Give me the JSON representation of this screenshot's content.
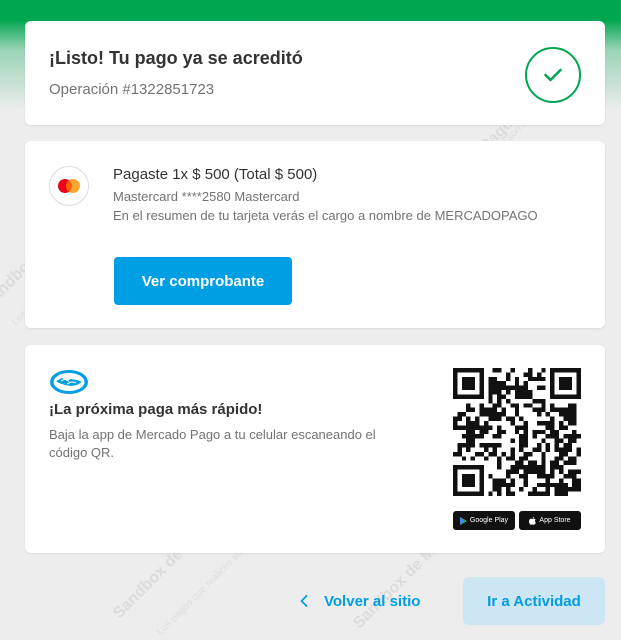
{
  "status": {
    "title": "¡Listo! Tu pago ya se acreditó",
    "operation": "Operación #1322851723",
    "icon": "check-icon",
    "color": "#00a650"
  },
  "payment": {
    "title": "Pagaste 1x $ 500 (Total $ 500)",
    "card": "Mastercard ****2580 Mastercard",
    "note": "En el resumen de tu tarjeta verás el cargo a nombre de MERCADOPAGO",
    "receipt_button": "Ver comprobante",
    "icon": "mastercard-icon"
  },
  "app_promo": {
    "title": "¡La próxima paga más rápido!",
    "text": "Baja la app de Mercado Pago a tu celular escaneando el código QR.",
    "google_play": "Google Play",
    "app_store": "App Store",
    "logo": "mercado-pago-logo"
  },
  "footer": {
    "back_label": "Volver al sitio",
    "activity_label": "Ir a Actividad"
  },
  "watermark": {
    "brand": "Sandbox de Mercado Pago",
    "disclaimer": "Los pagos que realices son ficticios."
  },
  "colors": {
    "accent": "#009ee3",
    "success": "#00a650",
    "background": "#ededed"
  }
}
